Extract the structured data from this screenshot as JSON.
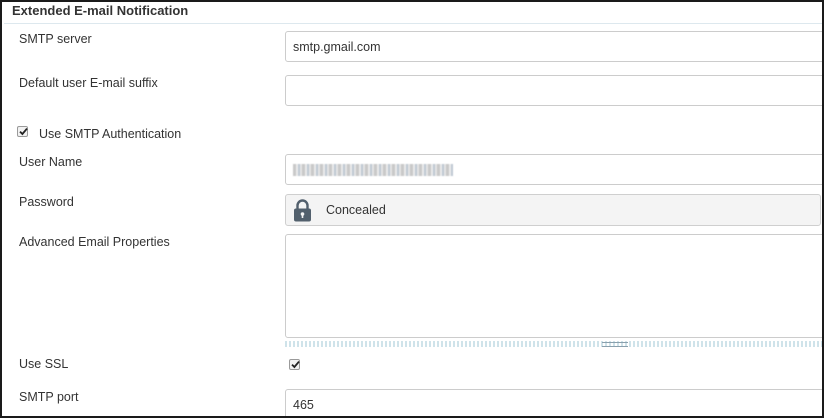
{
  "section": {
    "title": "Extended E-mail Notification"
  },
  "smtp_server": {
    "label": "SMTP server",
    "value": "smtp.gmail.com"
  },
  "default_suffix": {
    "label": "Default user E-mail suffix",
    "value": ""
  },
  "use_smtp_auth": {
    "label": "Use SMTP Authentication",
    "checked": true
  },
  "user_name": {
    "label": "User Name",
    "value_obscured": true
  },
  "password": {
    "label": "Password",
    "value": "Concealed",
    "icon": "lock-icon"
  },
  "advanced_props": {
    "label": "Advanced Email Properties",
    "value": ""
  },
  "use_ssl": {
    "label": "Use SSL",
    "checked": true
  },
  "smtp_port": {
    "label": "SMTP port",
    "value": "465"
  },
  "colors": {
    "border": "#cccccc",
    "section_rule": "#dde8ee",
    "text": "#333333",
    "frame": "#1a1a1a"
  }
}
